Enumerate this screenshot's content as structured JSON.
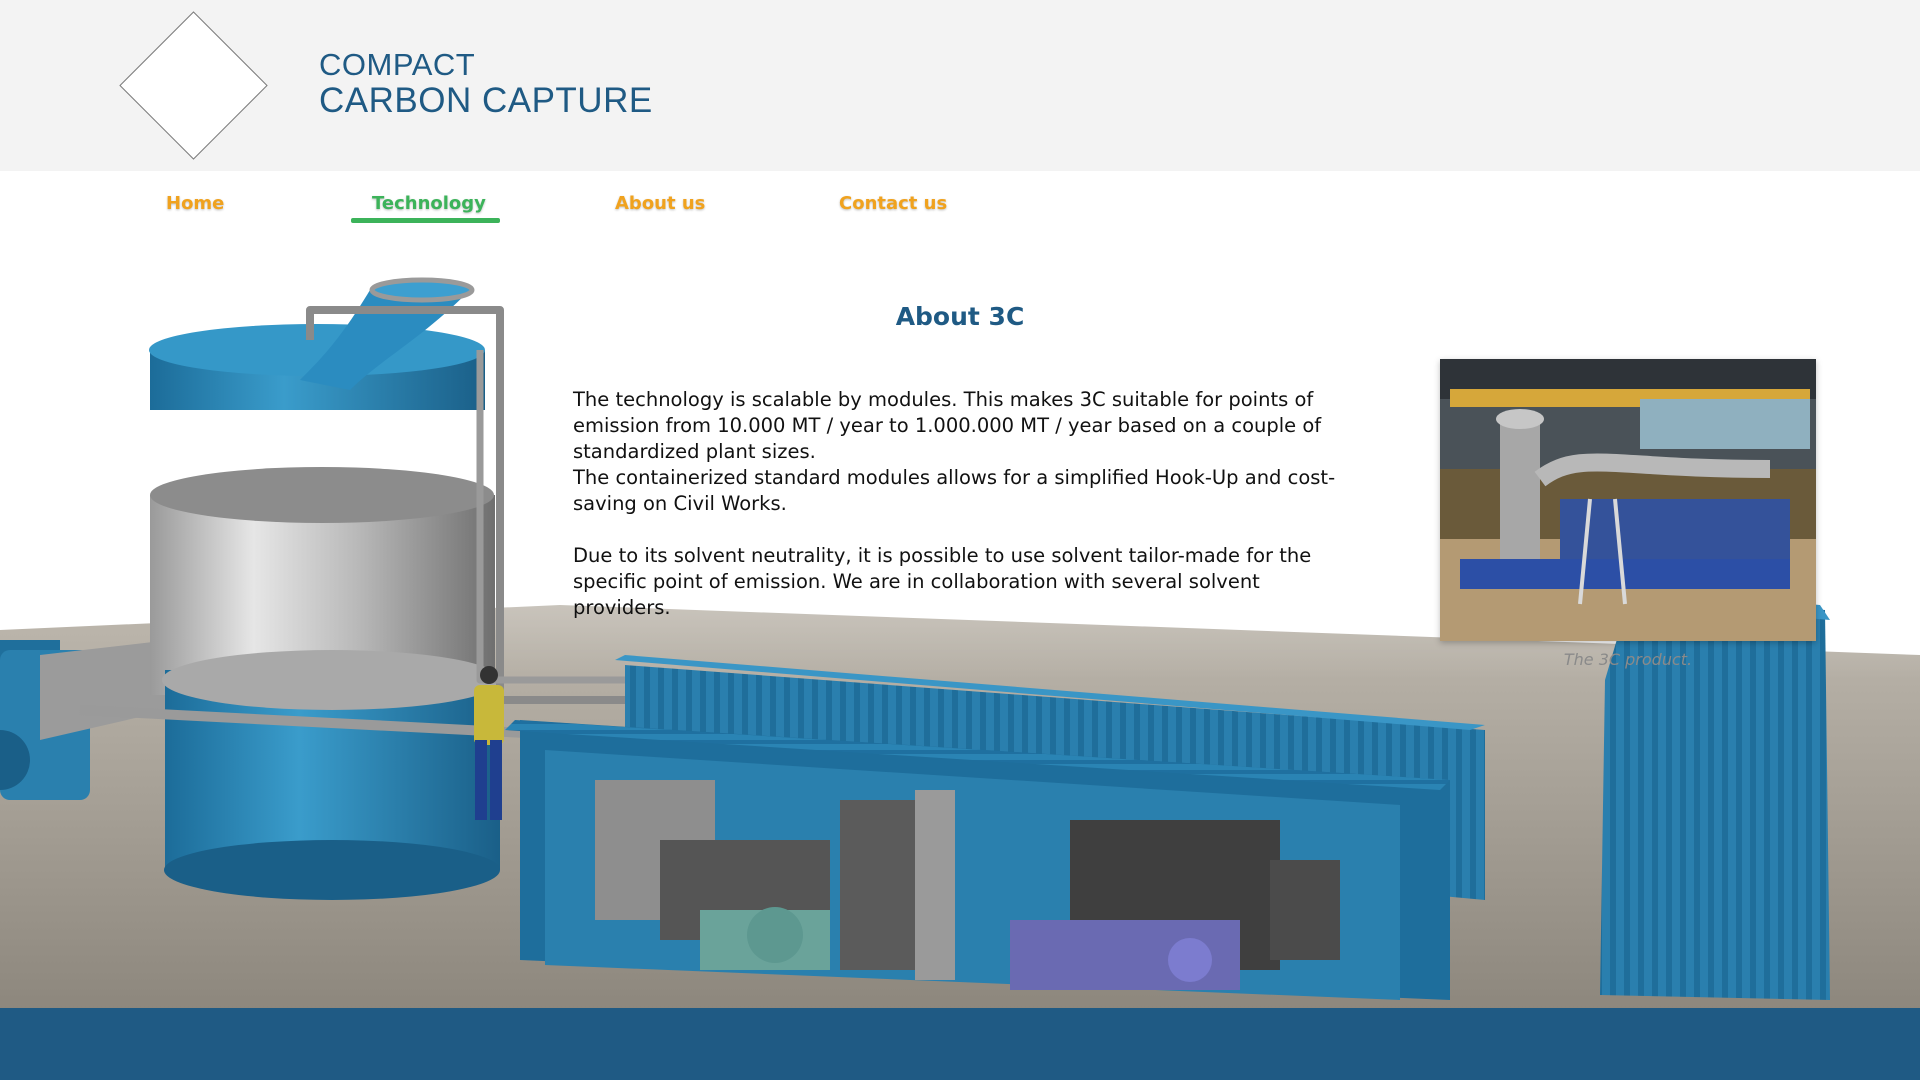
{
  "brand": {
    "line1": "COMPACT",
    "line2": "CARBON CAPTURE",
    "color": "#1f5a84"
  },
  "nav": {
    "items": [
      {
        "label": "Home",
        "active": false
      },
      {
        "label": "Technology",
        "active": true
      },
      {
        "label": "About us",
        "active": false
      },
      {
        "label": "Contact us",
        "active": false
      }
    ],
    "color": "#f0a21e",
    "active_color": "#3cb35a"
  },
  "content": {
    "title": "About 3C",
    "paragraph1_line1": "The technology is scalable by modules. This makes 3C suitable for points of emission from 10.000 MT / year to 1.000.000 MT / year based on a couple of standardized plant sizes.",
    "paragraph1_line2": "The containerized standard modules allows for a simplified Hook-Up and cost-saving on Civil Works.",
    "paragraph2": "Due to its solvent neutrality, it is possible to use solvent tailor-made for the specific point of emission. We are in collaboration with several solvent providers."
  },
  "photo": {
    "caption": "The 3C product."
  },
  "footer": {
    "color": "#1f5a84"
  }
}
